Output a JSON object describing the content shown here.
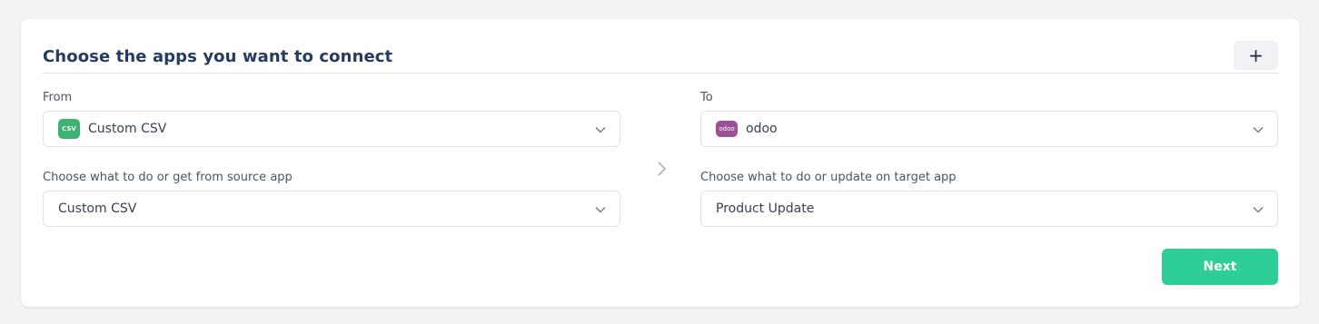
{
  "header": {
    "title": "Choose the apps you want to connect",
    "add_label": "+"
  },
  "from": {
    "label": "From",
    "app_name": "Custom CSV",
    "app_icon_text": "CSV",
    "app_icon_color": "#3cb371",
    "action_label": "Choose what to do or get from source app",
    "action_value": "Custom CSV"
  },
  "to": {
    "label": "To",
    "app_name": "odoo",
    "app_icon_text": "odoo",
    "app_icon_color": "#9b4f96",
    "action_label": "Choose what to do or update on target app",
    "action_value": "Product Update"
  },
  "actions": {
    "next_label": "Next",
    "next_color": "#2ecf96"
  },
  "icons": [
    "plus-icon",
    "chevron-down-icon",
    "chevron-right-icon"
  ]
}
